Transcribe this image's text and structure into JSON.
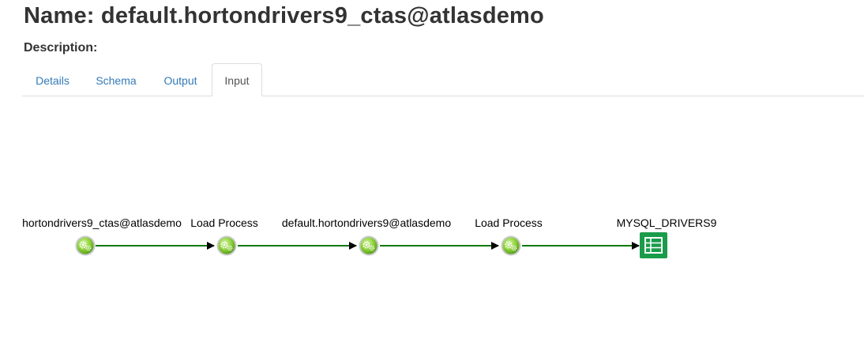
{
  "entity": {
    "title": "Name: default.hortondrivers9_ctas@atlasdemo",
    "description_label": "Description:"
  },
  "tabs": [
    {
      "label": "Details",
      "active": false
    },
    {
      "label": "Schema",
      "active": false
    },
    {
      "label": "Output",
      "active": false
    },
    {
      "label": "Input",
      "active": true
    }
  ],
  "lineage": {
    "edge_color": "#0b7a0b",
    "nodes": [
      {
        "label": "hortondrivers9_ctas@atlasdemo",
        "kind": "process-gear-icon"
      },
      {
        "label": "Load Process",
        "kind": "process-gear-icon"
      },
      {
        "label": "default.hortondrivers9@atlasdemo",
        "kind": "process-gear-icon"
      },
      {
        "label": "Load Process",
        "kind": "process-gear-icon"
      },
      {
        "label": "MYSQL_DRIVERS9",
        "kind": "table-icon"
      }
    ]
  }
}
